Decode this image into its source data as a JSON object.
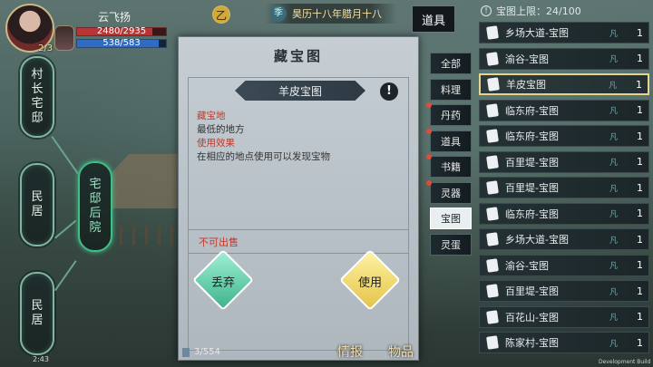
{
  "player": {
    "name": "云飞扬",
    "hp": "2480/2935",
    "hp_fraction": 0.845,
    "mp": "538/583",
    "mp_fraction": 0.923,
    "level": "2/3"
  },
  "header": {
    "badge": "乙",
    "date_icon": "季",
    "date": "昊历十八年腊月十八"
  },
  "map_nodes": {
    "n1": "村\n长\n宅\n邸",
    "n2": "宅\n邸\n后\n院",
    "n3": "民\n居",
    "n4": "民\n居"
  },
  "panel": {
    "title": "藏宝图",
    "item_name": "羊皮宝图",
    "info_icon": "!",
    "origin_label": "藏宝地",
    "origin_value": "最低的地方",
    "usage_label": "使用效果",
    "usage_value": "在相应的地点使用可以发现宝物",
    "not_for_sale": "不可出售",
    "discard_label": "丢弃",
    "use_label": "使用"
  },
  "categories": {
    "title": "道具",
    "tabs": [
      "全部",
      "料理",
      "丹药",
      "道具",
      "书籍",
      "灵器",
      "宝图",
      "灵蛋"
    ],
    "selected": "宝图"
  },
  "inventory": {
    "limit_icon": "!",
    "limit_text": "宝图上限：24/100",
    "mark": "凡",
    "items": [
      {
        "name": "乡场大道-宝图",
        "count": "1"
      },
      {
        "name": "渝谷-宝图",
        "count": "1"
      },
      {
        "name": "羊皮宝图",
        "count": "1"
      },
      {
        "name": "临东府-宝图",
        "count": "1"
      },
      {
        "name": "临东府-宝图",
        "count": "1"
      },
      {
        "name": "百里堤-宝图",
        "count": "1"
      },
      {
        "name": "百里堤-宝图",
        "count": "1"
      },
      {
        "name": "临东府-宝图",
        "count": "1"
      },
      {
        "name": "乡场大道-宝图",
        "count": "1"
      },
      {
        "name": "渝谷-宝图",
        "count": "1"
      },
      {
        "name": "百里堤-宝图",
        "count": "1"
      },
      {
        "name": "百花山-宝图",
        "count": "1"
      },
      {
        "name": "陈家村-宝图",
        "count": "1"
      }
    ],
    "selected_index": 2
  },
  "footer": {
    "clock": "2:43",
    "stack": "3/554",
    "tab_info": "情报",
    "tab_items": "物品",
    "build": "Development Build"
  },
  "colors": {
    "accent_green": "#3fbf86",
    "highlight_red": "#c0392b",
    "selected_border": "#e7d38a"
  }
}
